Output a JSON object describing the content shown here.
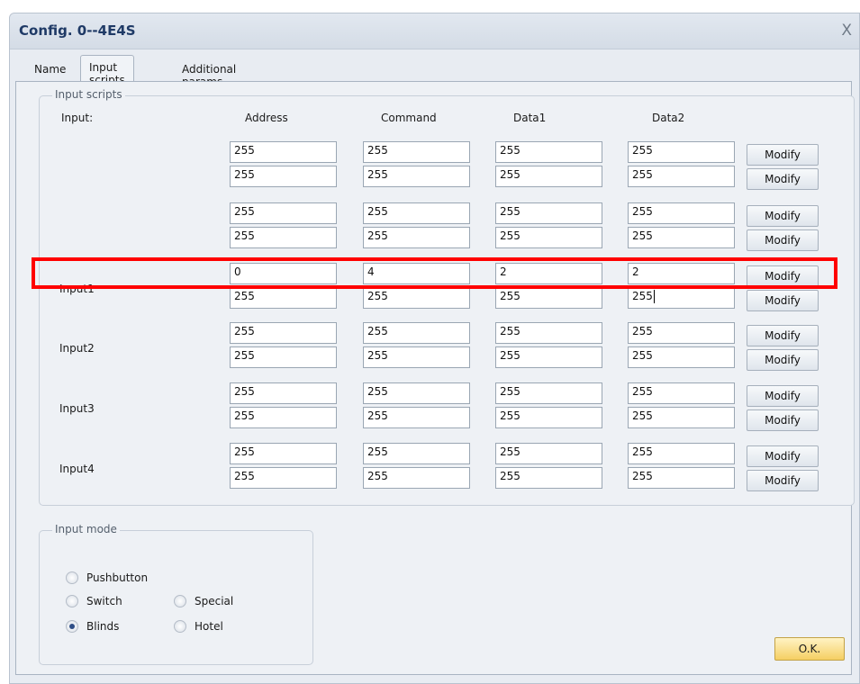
{
  "window": {
    "title": "Config. 0--4E4S",
    "close_glyph": "X"
  },
  "tabs": [
    {
      "label": "Name"
    },
    {
      "label": "Input scripts"
    },
    {
      "label": "Additional params."
    }
  ],
  "scripts": {
    "group_title": "Input scripts",
    "headers": {
      "input": "Input:",
      "address": "Address",
      "command": "Command",
      "data1": "Data1",
      "data2": "Data2"
    },
    "modify_label": "Modify",
    "rows": [
      {
        "label": "",
        "values": [
          [
            "255",
            "255",
            "255",
            "255"
          ],
          [
            "255",
            "255",
            "255",
            "255"
          ]
        ]
      },
      {
        "label": "",
        "values": [
          [
            "255",
            "255",
            "255",
            "255"
          ],
          [
            "255",
            "255",
            "255",
            "255"
          ]
        ]
      },
      {
        "label": "Input1",
        "values": [
          [
            "0",
            "4",
            "2",
            "2"
          ],
          [
            "255",
            "255",
            "255",
            "255"
          ]
        ]
      },
      {
        "label": "Input2",
        "values": [
          [
            "255",
            "255",
            "255",
            "255"
          ],
          [
            "255",
            "255",
            "255",
            "255"
          ]
        ]
      },
      {
        "label": "Input3",
        "values": [
          [
            "255",
            "255",
            "255",
            "255"
          ],
          [
            "255",
            "255",
            "255",
            "255"
          ]
        ]
      },
      {
        "label": "Input4",
        "values": [
          [
            "255",
            "255",
            "255",
            "255"
          ],
          [
            "255",
            "255",
            "255",
            "255"
          ]
        ]
      }
    ]
  },
  "input_mode": {
    "group_title": "Input mode",
    "options": [
      {
        "label": "Pushbutton",
        "checked": false
      },
      {
        "label": "Switch",
        "checked": false
      },
      {
        "label": "Special",
        "checked": false
      },
      {
        "label": "Blinds",
        "checked": true
      },
      {
        "label": "Hotel",
        "checked": false
      }
    ]
  },
  "ok_label": "O.K.",
  "colors": {
    "highlight": "#ff0000",
    "title": "#1f3a66",
    "ok_button": "#f5cf63"
  }
}
